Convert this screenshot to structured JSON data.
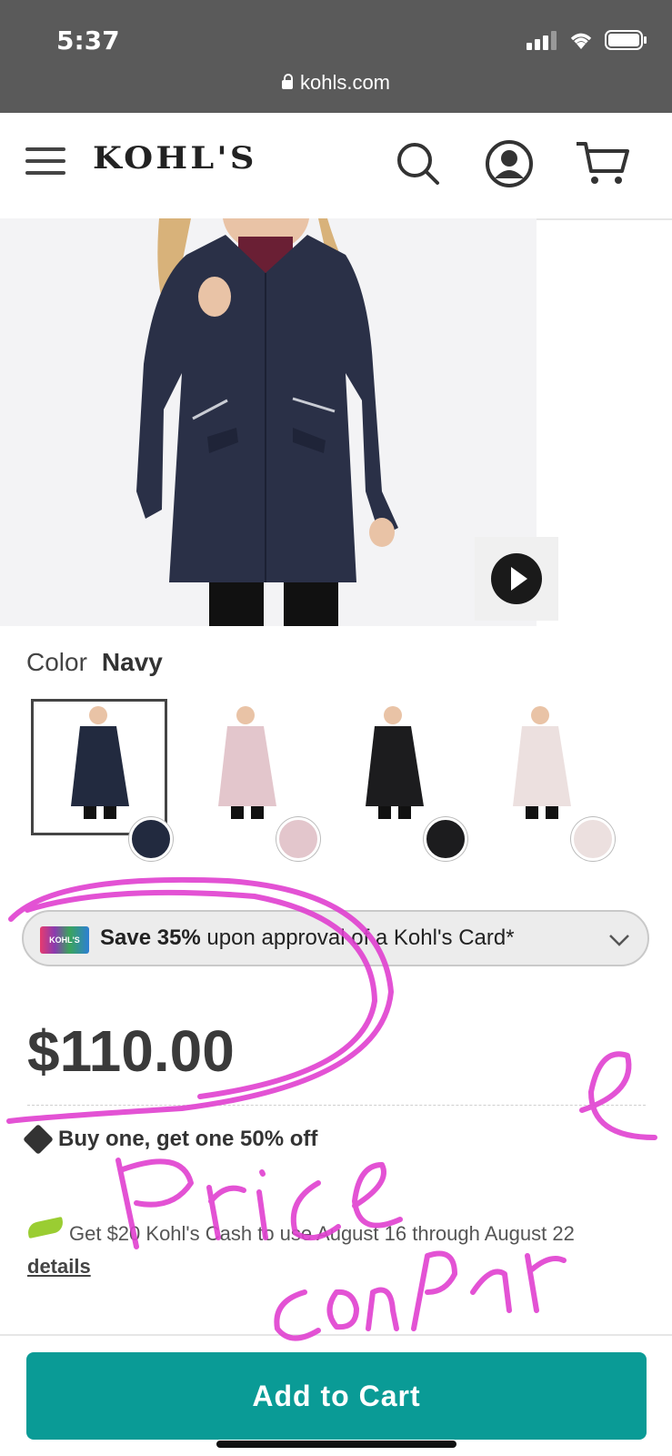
{
  "status_bar": {
    "time": "5:37",
    "url": "kohls.com"
  },
  "header": {
    "logo": "KOHL'S"
  },
  "product": {
    "color_label": "Color",
    "color_value": "Navy",
    "swatches": [
      {
        "name": "Navy",
        "hex": "#222a3f",
        "selected": true
      },
      {
        "name": "Pink",
        "hex": "#e3c6cc",
        "selected": false
      },
      {
        "name": "Black",
        "hex": "#1c1c1e",
        "selected": false
      },
      {
        "name": "Light Pink",
        "hex": "#ece0df",
        "selected": false
      }
    ],
    "promo": {
      "card_text": "KOHL'S",
      "bold": "Save 35%",
      "rest": " upon approval of a Kohl's Card*"
    },
    "price": "$110.00",
    "bogo": "Buy one, get one 50% off",
    "kohls_cash": {
      "text": "Get $20 Kohl's Cash to use August 16 through August 22 ",
      "link": "details"
    },
    "add_to_cart": "Add to Cart"
  },
  "colors": {
    "accent": "#0a9b96",
    "annotation": "#e040d0"
  }
}
